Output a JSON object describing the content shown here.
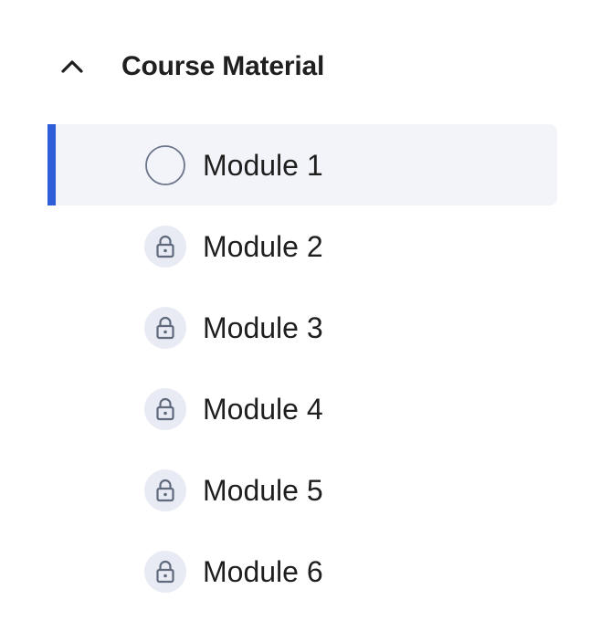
{
  "section": {
    "title": "Course Material",
    "expanded": true,
    "toggle_icon": "chevron-up-icon"
  },
  "colors": {
    "accent": "#2f5fd8",
    "active_row_bg": "#f3f4fa",
    "lock_badge_bg": "#e8ebf4",
    "icon_gray": "#5f6a7d"
  },
  "modules": [
    {
      "label": "Module 1",
      "status": "not-started",
      "icon": "empty-circle-icon",
      "active": true
    },
    {
      "label": "Module 2",
      "status": "locked",
      "icon": "lock-icon",
      "active": false
    },
    {
      "label": "Module 3",
      "status": "locked",
      "icon": "lock-icon",
      "active": false
    },
    {
      "label": "Module 4",
      "status": "locked",
      "icon": "lock-icon",
      "active": false
    },
    {
      "label": "Module 5",
      "status": "locked",
      "icon": "lock-icon",
      "active": false
    },
    {
      "label": "Module 6",
      "status": "locked",
      "icon": "lock-icon",
      "active": false
    }
  ]
}
